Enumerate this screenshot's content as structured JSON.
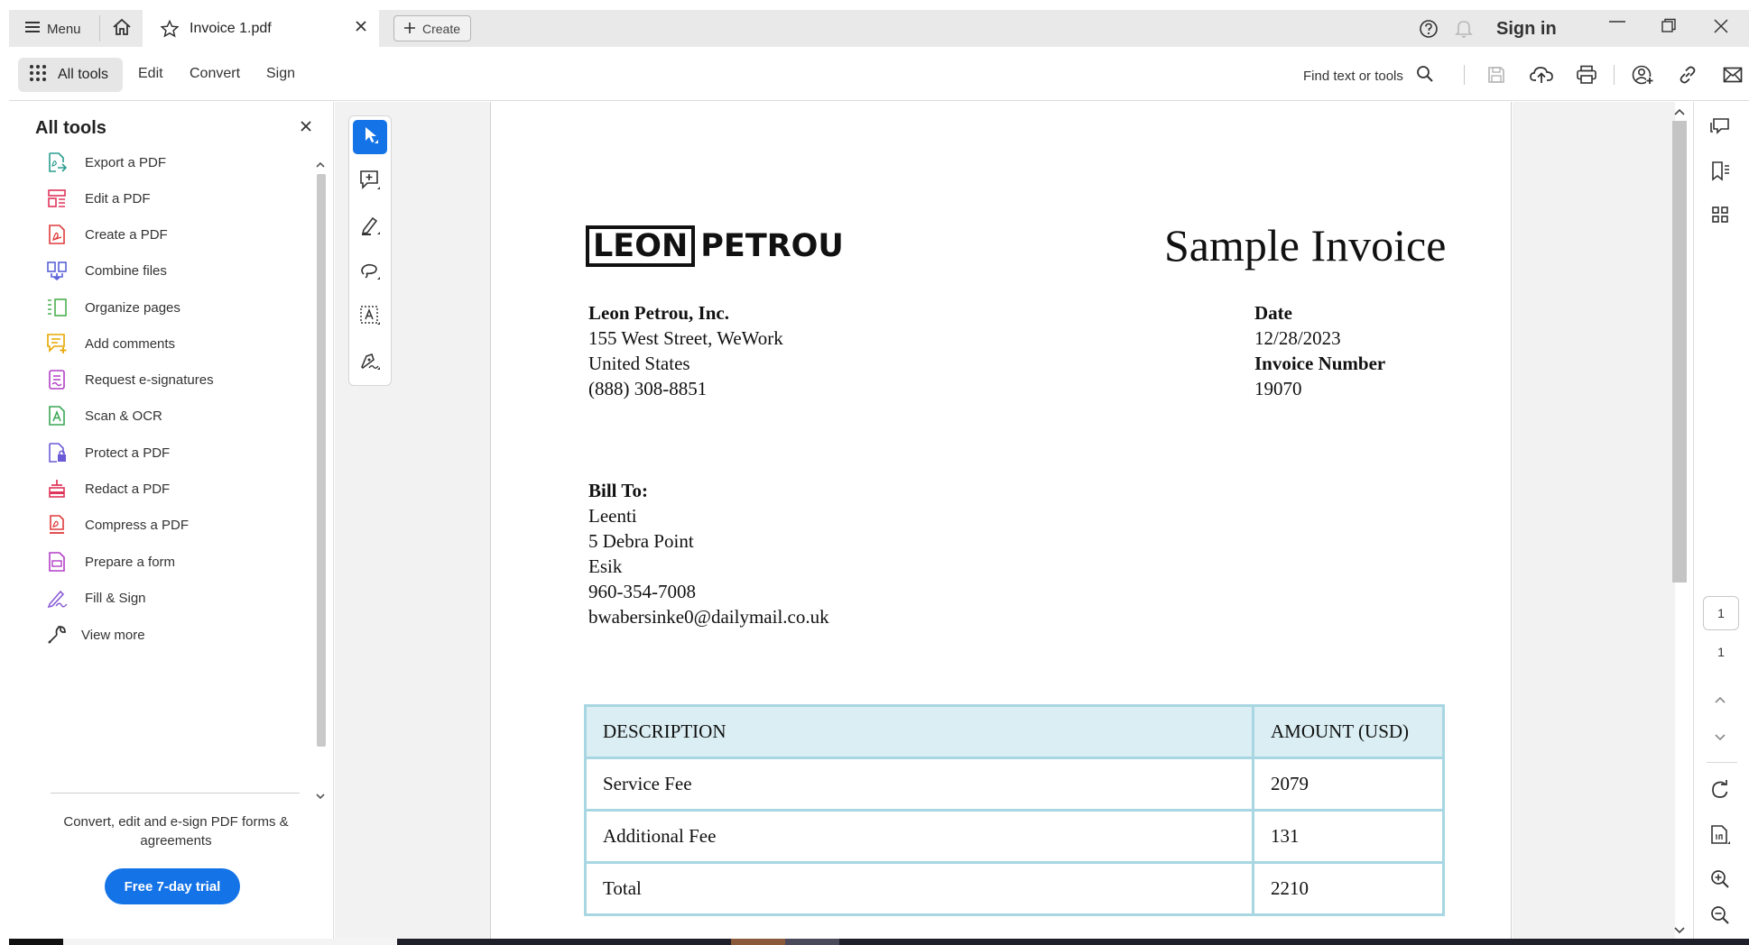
{
  "titlebar": {
    "menu_label": "Menu",
    "tab_title": "Invoice 1.pdf",
    "create_label": "Create",
    "signin_label": "Sign in"
  },
  "toolbar": {
    "all_tools_label": "All tools",
    "edit_label": "Edit",
    "convert_label": "Convert",
    "sign_label": "Sign",
    "find_label": "Find text or tools"
  },
  "left_panel": {
    "title": "All tools",
    "items": [
      {
        "label": "Export a PDF",
        "icon": "export-pdf-icon",
        "color": "#2a9d8f"
      },
      {
        "label": "Edit a PDF",
        "icon": "edit-pdf-icon",
        "color": "#e0355a"
      },
      {
        "label": "Create a PDF",
        "icon": "create-pdf-icon",
        "color": "#e03a3a"
      },
      {
        "label": "Combine files",
        "icon": "combine-files-icon",
        "color": "#5a62d8"
      },
      {
        "label": "Organize pages",
        "icon": "organize-pages-icon",
        "color": "#4caf50"
      },
      {
        "label": "Add comments",
        "icon": "add-comments-icon",
        "color": "#e6a700"
      },
      {
        "label": "Request e-signatures",
        "icon": "request-esignatures-icon",
        "color": "#b23fc7"
      },
      {
        "label": "Scan & OCR",
        "icon": "scan-ocr-icon",
        "color": "#3aa655"
      },
      {
        "label": "Protect a PDF",
        "icon": "protect-pdf-icon",
        "color": "#6b5bd6"
      },
      {
        "label": "Redact a PDF",
        "icon": "redact-pdf-icon",
        "color": "#e0355a"
      },
      {
        "label": "Compress a PDF",
        "icon": "compress-pdf-icon",
        "color": "#e03a3a"
      },
      {
        "label": "Prepare a form",
        "icon": "prepare-form-icon",
        "color": "#b23fc7"
      },
      {
        "label": "Fill & Sign",
        "icon": "fill-sign-icon",
        "color": "#8a5bd6"
      },
      {
        "label": "View more",
        "icon": "wrench-icon",
        "color": "#333333"
      }
    ],
    "promo_text": "Convert, edit and e-sign PDF forms & agreements",
    "trial_label": "Free 7-day trial"
  },
  "document": {
    "logo_left": "LEON",
    "logo_right": "PETROU",
    "title": "Sample Invoice",
    "company_name": "Leon Petrou, Inc.",
    "address_line1": "155 West Street, WeWork",
    "address_line2": "United States",
    "phone": "(888) 308-8851",
    "date_label": "Date",
    "date_value": "12/28/2023",
    "invoice_number_label": "Invoice Number",
    "invoice_number_value": "19070",
    "bill_to_label": "Bill To:",
    "bill_name": "Leenti",
    "bill_street": "5 Debra Point",
    "bill_city": "Esik",
    "bill_phone": "960-354-7008",
    "bill_email": "bwabersinke0@dailymail.co.uk",
    "table": {
      "headers": [
        "DESCRIPTION",
        "AMOUNT (USD)"
      ],
      "rows": [
        [
          "Service Fee",
          "2079"
        ],
        [
          "Additional Fee",
          "131"
        ],
        [
          "Total",
          "2210"
        ]
      ]
    }
  },
  "right_rail": {
    "current_page": "1",
    "total_pages": "1"
  },
  "colors": {
    "accent": "#1473e6",
    "table_border": "#a8d6e2",
    "table_header_bg": "#daeef3"
  }
}
